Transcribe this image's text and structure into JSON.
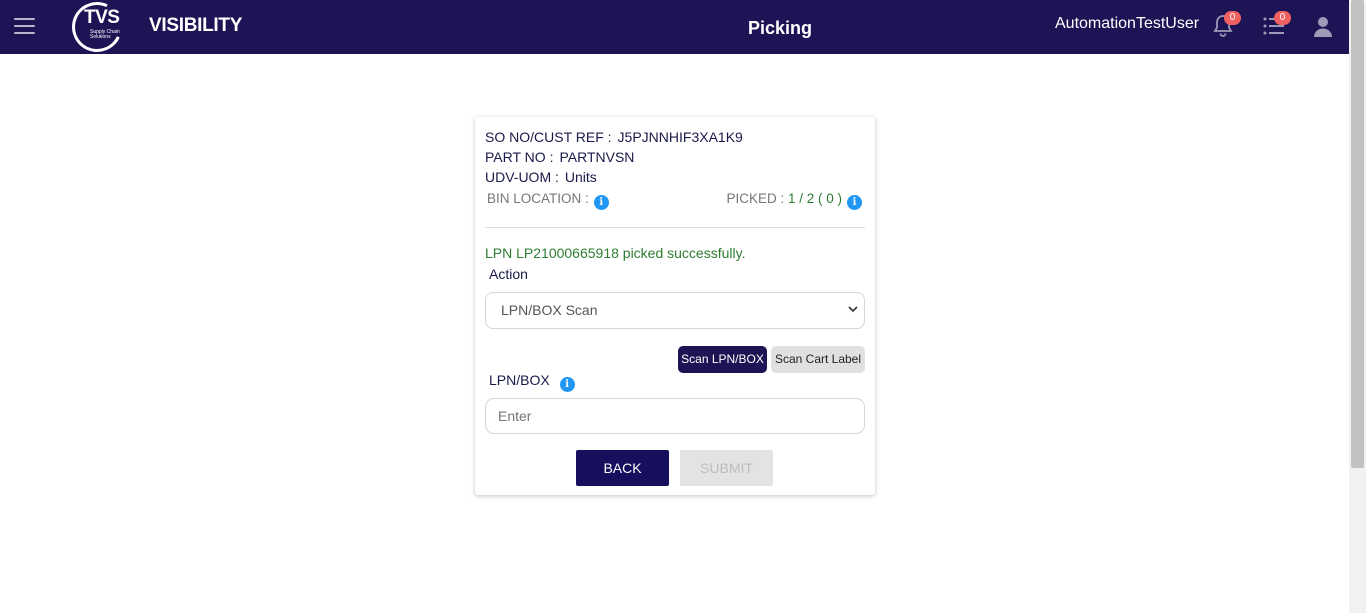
{
  "header": {
    "logo_text": "TVS",
    "logo_subtext": "Supply Chain Solutions",
    "brand": "VISIBILITY",
    "title": "Picking",
    "username": "AutomationTestUser",
    "notifications_count": "0",
    "tasks_count": "0",
    "badge_color": "#f06060",
    "bar_color": "#1c1454"
  },
  "card": {
    "so_label": "SO NO/CUST REF  :",
    "so_value": "J5PJNNHIF3XA1K9",
    "part_label": "PART NO :",
    "part_value": "PARTNVSN",
    "uom_label": "UDV-UOM  :",
    "uom_value": "Units",
    "bin_label": "BIN LOCATION :",
    "picked_label": "PICKED :",
    "picked_value": "1 / 2 ( 0 )",
    "success_message": "LPN LP21000665918 picked successfully.",
    "action_label": "Action",
    "action_selected": "LPN/BOX Scan",
    "scan_lpn_button": "Scan LPN/BOX",
    "scan_cart_button": "Scan Cart Label",
    "lpn_label": "LPN/BOX",
    "lpn_placeholder": "Enter",
    "back_button": "BACK",
    "submit_button": "SUBMIT"
  }
}
